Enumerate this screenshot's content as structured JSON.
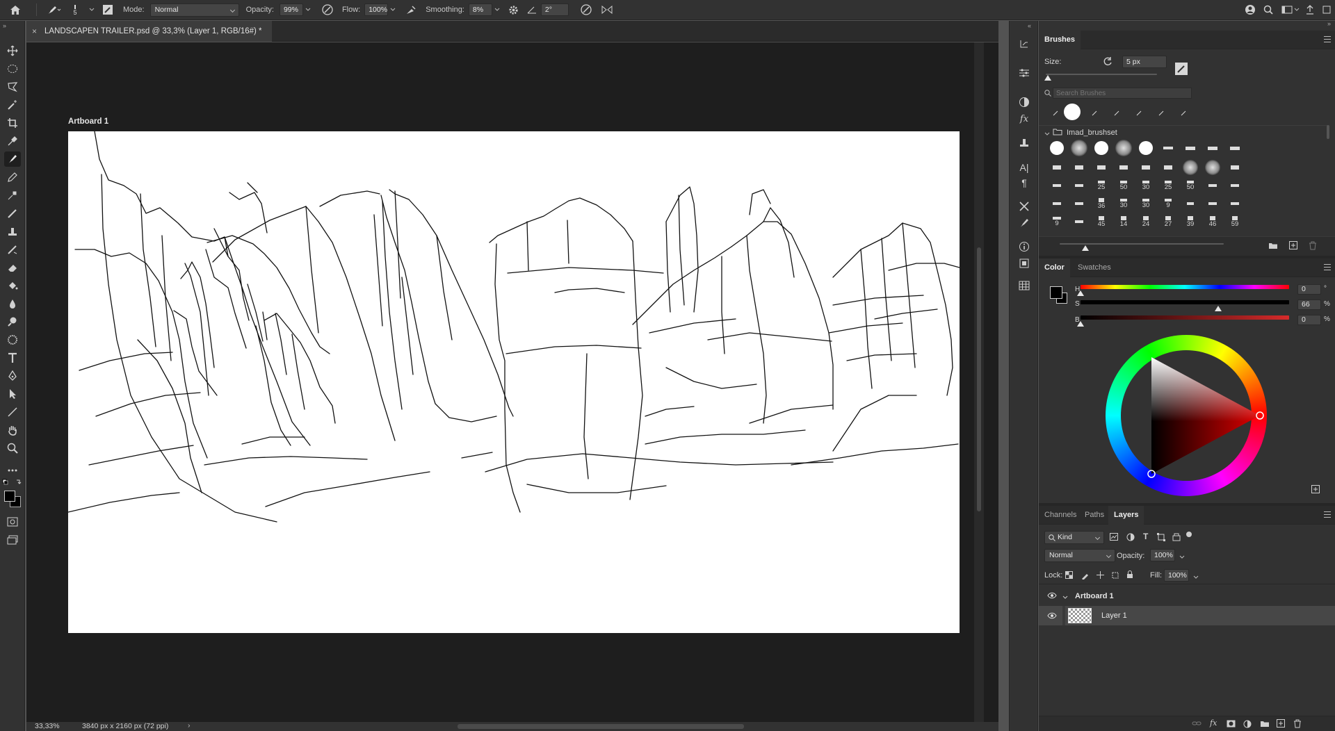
{
  "options_bar": {
    "brush_size": "5",
    "mode_label": "Mode:",
    "mode_value": "Normal",
    "opacity_label": "Opacity:",
    "opacity_value": "99%",
    "flow_label": "Flow:",
    "flow_value": "100%",
    "smoothing_label": "Smoothing:",
    "smoothing_value": "8%",
    "angle_value": "2°"
  },
  "document": {
    "tab_title": "LANDSCAPEN TRAILER.psd @ 33,3% (Layer 1, RGB/16#) *",
    "artboard_label": "Artboard 1"
  },
  "status_bar": {
    "zoom": "33,33%",
    "doc_info": "3840 px x 2160 px (72 ppi)"
  },
  "brushes_panel": {
    "title": "Brushes",
    "size_label": "Size:",
    "size_value": "5 px",
    "search_placeholder": "Search Brushes",
    "folder_name": "Imad_brushset",
    "numbered_rows": [
      [
        "",
        "",
        "25",
        "50",
        "30",
        "25",
        "50",
        "",
        ""
      ],
      [
        "",
        "",
        "36",
        "30",
        "30",
        "9",
        "",
        "",
        ""
      ],
      [
        "9",
        "",
        "45",
        "14",
        "24",
        "27",
        "39",
        "46",
        "59"
      ]
    ]
  },
  "color_panel": {
    "tabs": [
      "Color",
      "Swatches"
    ],
    "h_label": "H",
    "h_value": "0",
    "h_unit": "°",
    "s_label": "S",
    "s_value": "66",
    "s_unit": "%",
    "b_label": "B",
    "b_value": "0",
    "b_unit": "%",
    "hue_position": 0,
    "saturation_position": 0.66,
    "brightness_position": 0,
    "foreground_color": "#000000",
    "background_color": "#000000"
  },
  "layers_panel": {
    "tabs": [
      "Channels",
      "Paths",
      "Layers"
    ],
    "kind_label": "Kind",
    "blend_mode": "Normal",
    "opacity_label": "Opacity:",
    "opacity_value": "100%",
    "lock_label": "Lock:",
    "fill_label": "Fill:",
    "fill_value": "100%",
    "layers": [
      {
        "name": "Artboard 1"
      },
      {
        "name": "Layer 1"
      }
    ]
  }
}
